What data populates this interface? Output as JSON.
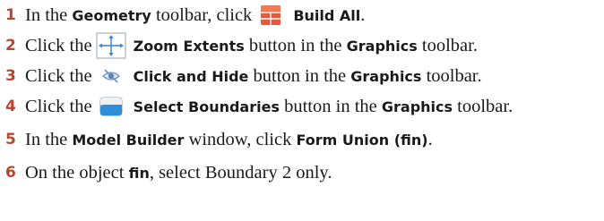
{
  "steps": [
    {
      "num": "1",
      "parts": [
        "In the ",
        "Geometry",
        " toolbar, click",
        "Build All",
        "."
      ]
    },
    {
      "num": "2",
      "parts": [
        "Click the",
        "Zoom Extents",
        " button in the ",
        "Graphics",
        " toolbar."
      ]
    },
    {
      "num": "3",
      "parts": [
        "Click the",
        "Click and Hide",
        " button in the ",
        "Graphics",
        " toolbar."
      ]
    },
    {
      "num": "4",
      "parts": [
        "Click the",
        "Select Boundaries",
        " button in the ",
        "Graphics",
        " toolbar."
      ]
    },
    {
      "num": "5",
      "parts": [
        "In the ",
        "Model Builder",
        " window, click ",
        "Form Union (fin)",
        "."
      ]
    },
    {
      "num": "6",
      "parts": [
        "On the object ",
        "fin",
        ", select Boundary 2 only."
      ]
    }
  ],
  "icons": {
    "build_all": "build-all-icon",
    "zoom_extents": "zoom-extents-icon",
    "click_and_hide": "click-and-hide-icon",
    "select_boundaries": "select-boundaries-icon"
  },
  "colors": {
    "step_number": "#b8452e",
    "build_all_icon": "#e8593a"
  }
}
